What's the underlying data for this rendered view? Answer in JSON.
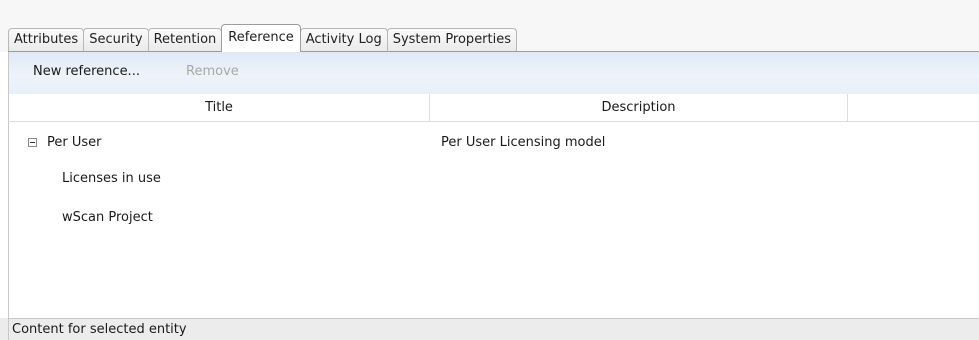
{
  "tabs": [
    {
      "label": "Attributes",
      "active": false
    },
    {
      "label": "Security",
      "active": false
    },
    {
      "label": "Retention",
      "active": false
    },
    {
      "label": "Reference",
      "active": true
    },
    {
      "label": "Activity Log",
      "active": false
    },
    {
      "label": "System Properties",
      "active": false
    }
  ],
  "toolbar": {
    "new_reference_label": "New reference...",
    "remove_label": "Remove"
  },
  "table": {
    "columns": [
      "Title",
      "Description"
    ],
    "rows": [
      {
        "title": "Per User",
        "description": "Per User Licensing model",
        "expander_icon": "collapse-minus-icon",
        "level": 0
      },
      {
        "title": "Licenses in use",
        "description": "",
        "level": 1
      },
      {
        "title": "wScan Project",
        "description": "",
        "level": 1
      }
    ]
  },
  "status": {
    "text": "Content for selected entity"
  }
}
